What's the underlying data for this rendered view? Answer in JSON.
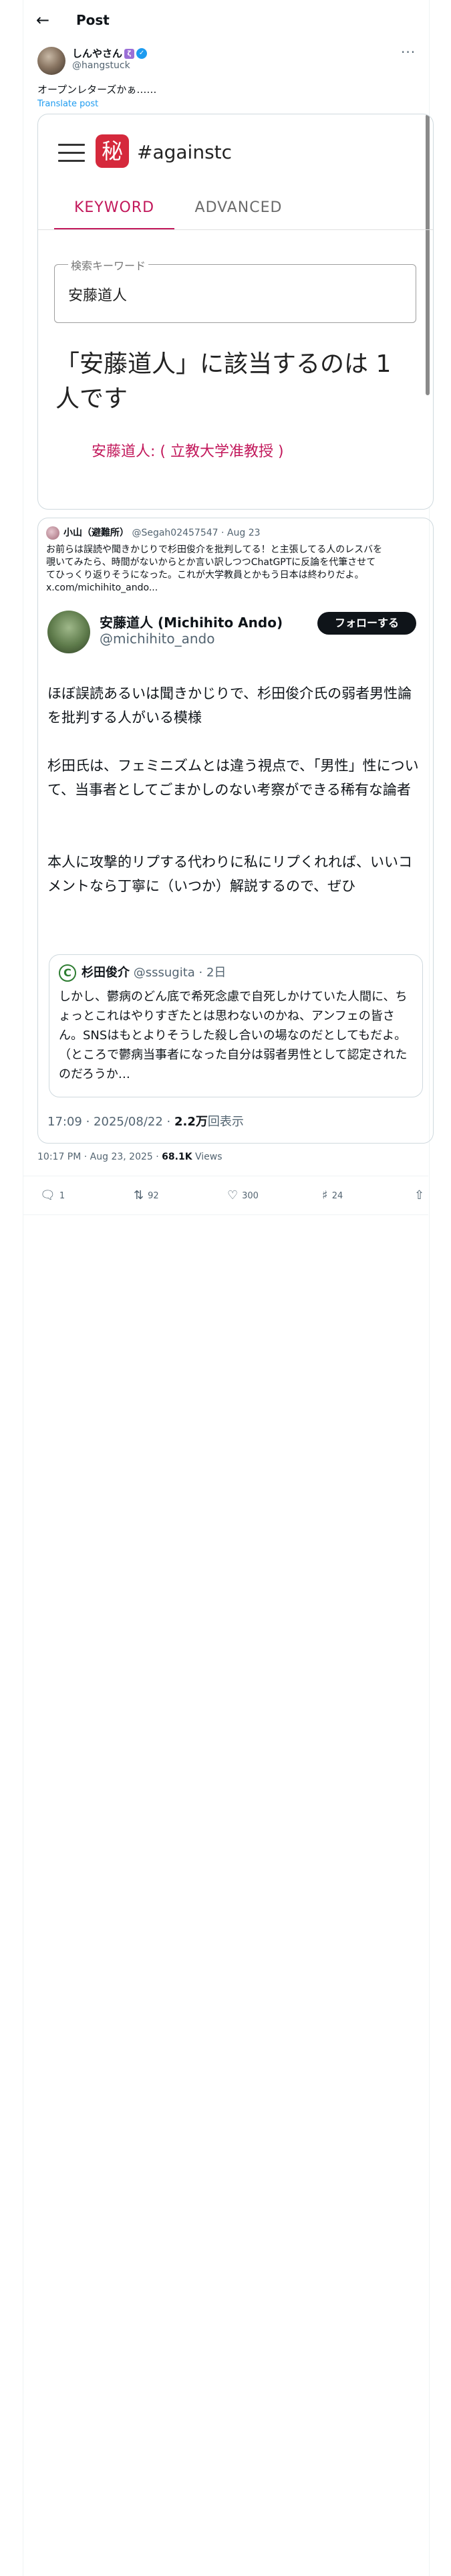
{
  "header": {
    "back_icon": "arrow-left-icon",
    "title": "Post"
  },
  "author": {
    "name": "しんやさん",
    "badge_label": "ζ",
    "verified_icon": "verified-badge-icon",
    "handle": "@hangstuck"
  },
  "post": {
    "text": "オープンレターズかぁ……",
    "translate_label": "Translate post",
    "more_icon": "ellipsis-icon"
  },
  "media": {
    "logo_char": "秘",
    "site_title": "#againstc",
    "tabs": [
      "KEYWORD",
      "ADVANCED"
    ],
    "search_label": "検索キーワード",
    "search_value": "安藤道人",
    "result_text": "「安藤道人」に該当するのは 1 人です",
    "result_link": "安藤道人: ( 立教大学准教授 )",
    "accent": "#c2185b"
  },
  "quote": {
    "name": "小山（避難所）",
    "handle": "@Segah02457547",
    "date": "· Aug 23",
    "text_lines": [
      "お前らは誤読や聞きかじりで杉田俊介を批判してる！と主張してる人のレスバを",
      "覗いてみたら、時間がないからとか言い訳しつつChatGPTに反論を代筆させて",
      "てひっくり返りそうになった。これが大学教員とかもう日本は終わりだよ。",
      "x.com/michihito_ando..."
    ],
    "embedded": {
      "name": "安藤道人 (Michihito Ando)",
      "handle": "@michihito_ando",
      "follow_label": "フォローする",
      "paragraphs": [
        "ほぼ誤読あるいは聞きかじりで、杉田俊介氏の弱者男性論を批判する人がいる模様",
        "杉田氏は、フェミニズムとは違う視点で、「男性」性について、当事者としてごまかしのない考察ができる稀有な論者",
        "本人に攻撃的リプする代わりに私にリプくれれば、いいコメントなら丁寧に（いつか）解説するので、ぜひ"
      ],
      "inner": {
        "avatar_char": "C",
        "name": "杉田俊介",
        "handle": "@sssugita",
        "date": "· 2日",
        "text": "しかし、鬱病のどん底で希死念慮で自死しかけていた人間に、ちょっとこれはやりすぎたとは思わないのかね、アンフェの皆さん。SNSはもとよりそうした殺し合いの場なのだとしてもだよ。（ところで鬱病当事者になった自分は弱者男性として認定されたのだろうか…"
      },
      "time": "17:09 · 2025/08/22",
      "views_count": "2.2万",
      "views_label": "回表示"
    }
  },
  "meta": {
    "time": "10:17 PM · Aug 23, 2025",
    "views_count": "68.1K",
    "views_label": "Views"
  },
  "actions": [
    {
      "icon": "reply-icon",
      "count": "1"
    },
    {
      "icon": "repost-icon",
      "count": "92"
    },
    {
      "icon": "like-icon",
      "count": "300"
    },
    {
      "icon": "bookmark-icon",
      "count": "24"
    },
    {
      "icon": "share-icon",
      "count": ""
    }
  ]
}
